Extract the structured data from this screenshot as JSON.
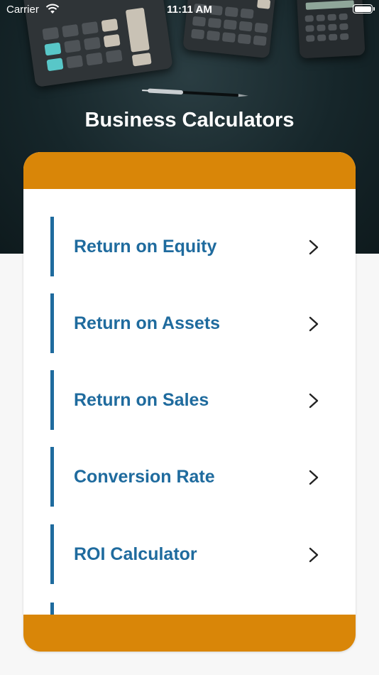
{
  "status_bar": {
    "carrier": "Carrier",
    "time": "11:11 AM"
  },
  "header": {
    "title": "Business Calculators"
  },
  "menu": {
    "items": [
      {
        "label": "Return on Equity",
        "icon": "chevron-right-icon"
      },
      {
        "label": "Return on Assets",
        "icon": "chevron-right-icon"
      },
      {
        "label": "Return on Sales",
        "icon": "chevron-right-icon"
      },
      {
        "label": "Conversion Rate",
        "icon": "chevron-right-icon"
      },
      {
        "label": "ROI Calculator",
        "icon": "chevron-right-icon"
      }
    ]
  },
  "colors": {
    "accent_orange": "#d98608",
    "accent_blue": "#1f6b9e",
    "hero_dark": "#16262a"
  }
}
